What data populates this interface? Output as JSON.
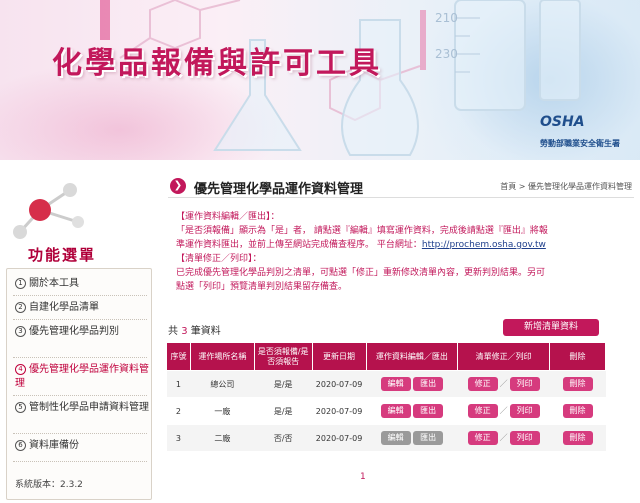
{
  "banner": {
    "title": "化學品報備與許可工具",
    "agency": "勞動部職業安全衛生署",
    "logo_text": "OSHA",
    "beaker_marks": [
      "210",
      "230"
    ]
  },
  "sidebar": {
    "title": "功能選單",
    "items": [
      {
        "num": "1",
        "label": "關於本工具"
      },
      {
        "num": "2",
        "label": "自建化學品清單"
      },
      {
        "num": "3",
        "label": "優先管理化學品判別"
      },
      {
        "num": "4",
        "label": "優先管理化學品運作資料管理"
      },
      {
        "num": "5",
        "label": "管制性化學品申請資料管理"
      },
      {
        "num": "6",
        "label": "資料庫備份"
      }
    ],
    "version": "系統版本：2.3.2"
  },
  "header": {
    "title": "優先管理化學品運作資料管理",
    "breadcrumb": "首頁 > 優先管理化學品運作資料管理"
  },
  "instructions": {
    "line1": "【運作資料編輯／匯出】：",
    "line2": "「是否須報備」顯示為「是」者， 請點選『編輯』填寫運作資料，完成後請點選『匯出』將報",
    "line3": "準運作資料匯出，並前上傳至網站完成備查程序。 平台網址：",
    "link": "http://prochem.osha.gov.tw",
    "line4": "【清單修正／列印】：",
    "line5": "已完成優先管理化學品判別之清單，可點選「修正」重新修改清單內容，更新判別結果。另可",
    "line6": "點選「列印」預覽清單判別結果留存備查。"
  },
  "listing": {
    "count_prefix": "共",
    "count": "3",
    "count_suffix": "筆資料",
    "add_button": "新增清單資料",
    "columns": [
      "序號",
      "運作場所名稱",
      "是否須報備/是否須報告",
      "更新日期",
      "運作資料編輯／匯出",
      "清單修正／列印",
      "刪除"
    ],
    "rows": [
      {
        "seq": "1",
        "site": "總公司",
        "flag": "是/是",
        "date": "2020-07-09",
        "edit": "編輯",
        "export": "匯出",
        "fix": "修正",
        "print": "列印",
        "delete": "刪除",
        "edit_enabled": true
      },
      {
        "seq": "2",
        "site": "一廠",
        "flag": "是/是",
        "date": "2020-07-09",
        "edit": "編輯",
        "export": "匯出",
        "fix": "修正",
        "print": "列印",
        "delete": "刪除",
        "edit_enabled": true
      },
      {
        "seq": "3",
        "site": "二廠",
        "flag": "否/否",
        "date": "2020-07-09",
        "edit": "編輯",
        "export": "匯出",
        "fix": "修正",
        "print": "列印",
        "delete": "刪除",
        "edit_enabled": false
      }
    ]
  },
  "pager": {
    "current": "1"
  },
  "colors": {
    "accent": "#c2185b",
    "header_row": "#b5124d",
    "button": "#d63b7e",
    "disabled": "#9a9a9a"
  }
}
